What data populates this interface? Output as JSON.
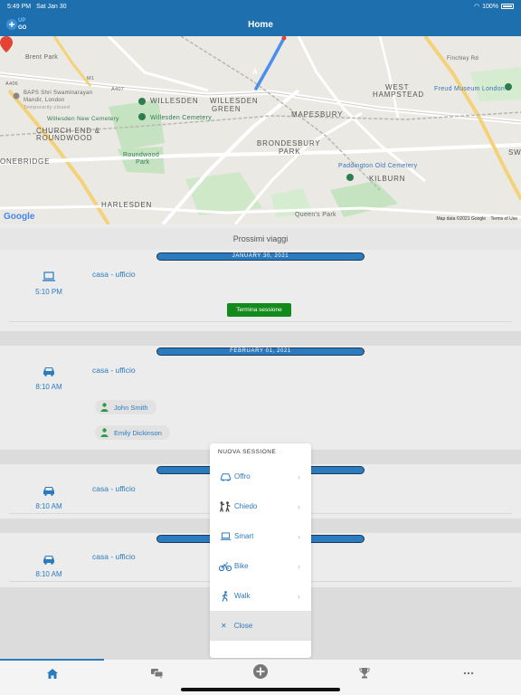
{
  "status_bar": {
    "time": "5:49 PM",
    "date": "Sat Jan 30",
    "battery": "100%"
  },
  "header": {
    "title": "Home",
    "logo_text_top": "UP",
    "logo_text_bottom": "GO"
  },
  "map": {
    "labels": {
      "brent_park": "Brent Park",
      "baps_line1": "BAPS Shri Swaminarayan",
      "baps_line2": "Mandir, London",
      "baps_line3": "Temporarily closed",
      "willesden_new_cemetery": "Willesden New Cemetery",
      "willesden_cemetery": "Willesden Cemetery",
      "church_end_1": "CHURCH END &",
      "church_end_2": "ROUNDWOOD",
      "roundwood_park_1": "Roundwood",
      "roundwood_park_2": "Park",
      "willesden": "WILLESDEN",
      "willesden_green_1": "WILLESDEN",
      "willesden_green_2": "GREEN",
      "mapesbury": "MAPESBURY",
      "brondesbury_1": "BRONDESBURY",
      "brondesbury_2": "PARK",
      "west_hampstead_1": "WEST",
      "west_hampstead_2": "HAMPSTEAD",
      "freud_museum": "Freud Museum London",
      "paddington_cemetery": "Paddington Old Cemetery",
      "kilburn": "KILBURN",
      "onebridge": "ONEBRIDGE",
      "harlesden": "HARLESDEN",
      "queens_park": "Queen's Park",
      "finchley_rd": "Finchley Rd",
      "sw": "SW",
      "a407": "A407",
      "a406": "A406",
      "m1": "M1"
    },
    "google_logo": "Google",
    "map_data": "Map data ©2021 Google",
    "terms": "Terms of Use",
    "pin_label": "A"
  },
  "section_title": "Prossimi viaggi",
  "trips": [
    {
      "date": "JANUARY 30, 2021",
      "icon": "laptop-icon",
      "time": "5:10 PM",
      "name": "casa - ufficio",
      "action": "Termina sessione",
      "people": []
    },
    {
      "date": "FEBRUARY 01, 2021",
      "icon": "car-icon",
      "time": "8:10 AM",
      "name": "casa - ufficio",
      "people": [
        "John Smith",
        "Emily Dickinson"
      ]
    },
    {
      "date": "",
      "icon": "car-icon",
      "time": "8:10 AM",
      "name": "casa - ufficio",
      "people": []
    },
    {
      "date": "",
      "icon": "car-icon",
      "time": "8:10 AM",
      "name": "casa - ufficio",
      "people": []
    }
  ],
  "popup": {
    "header": "NUOVA SESSIONE",
    "items": [
      {
        "label": "Offro",
        "icon": "car-icon"
      },
      {
        "label": "Chiedo",
        "icon": "hitchhike-icon"
      },
      {
        "label": "Smart",
        "icon": "laptop-icon"
      },
      {
        "label": "Bike",
        "icon": "bike-icon"
      },
      {
        "label": "Walk",
        "icon": "walk-icon"
      }
    ],
    "close_label": "Close"
  },
  "tabs": [
    {
      "name": "home-tab",
      "icon": "home-icon",
      "active": true
    },
    {
      "name": "chat-tab",
      "icon": "chat-icon"
    },
    {
      "name": "add-tab",
      "icon": "plus-circle-icon"
    },
    {
      "name": "trophy-tab",
      "icon": "trophy-icon"
    },
    {
      "name": "more-tab",
      "icon": "more-icon"
    }
  ],
  "colors": {
    "header": "#1e6fae",
    "accent": "#2b7bbf",
    "action_green": "#138a1c",
    "route": "#4a8ef0",
    "pin": "#e34234"
  }
}
